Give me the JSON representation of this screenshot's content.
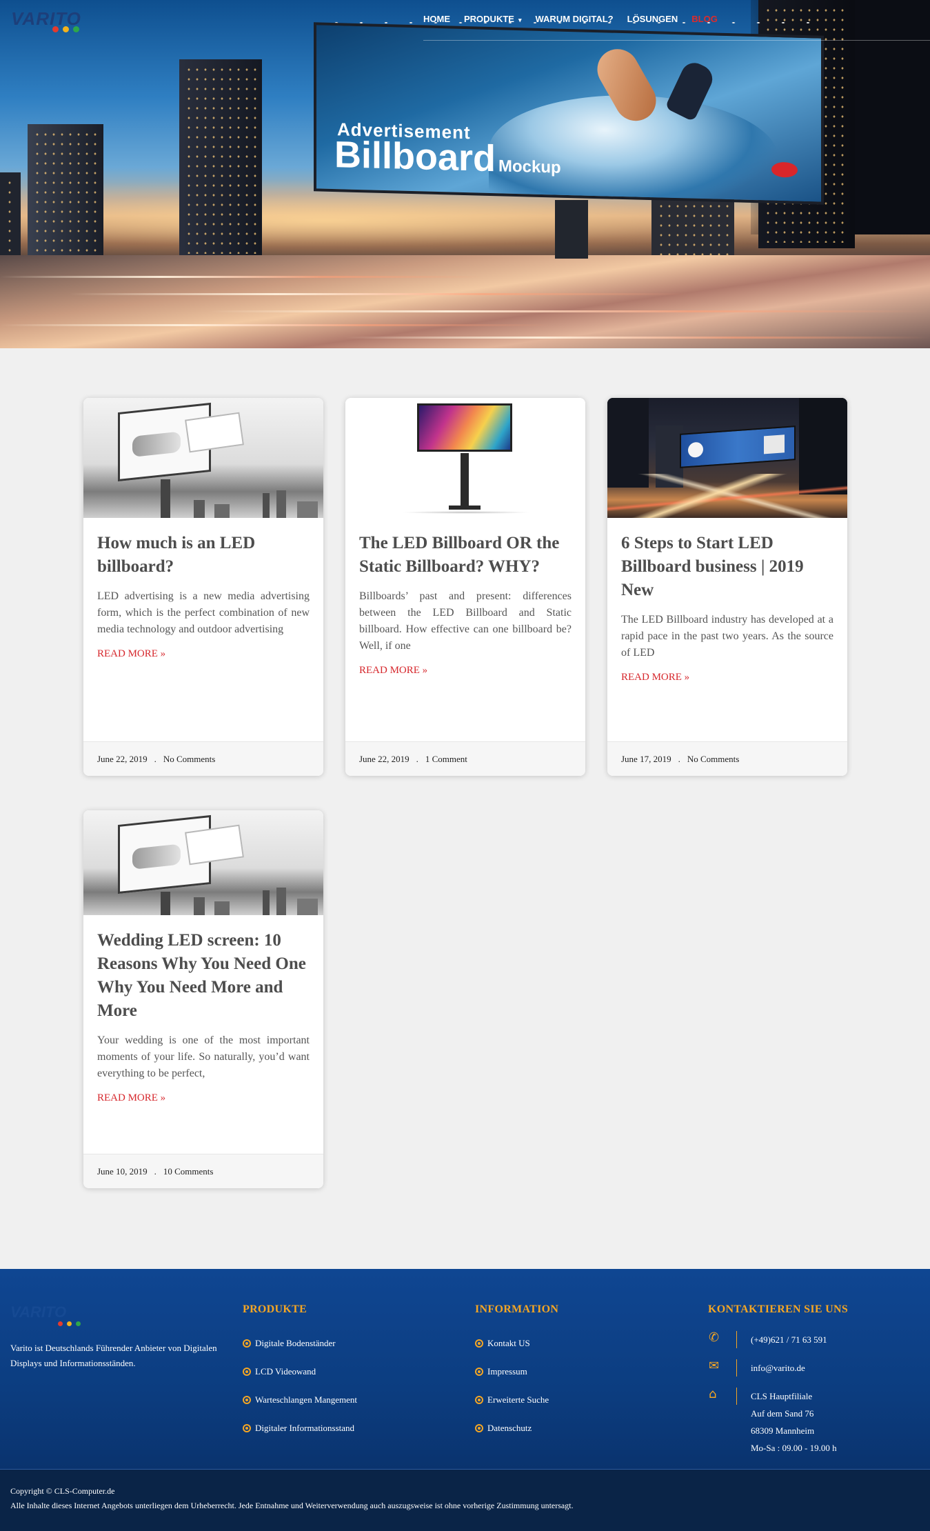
{
  "header": {
    "logo_text": "VARITO",
    "logo_dot_colors": [
      "#e33b2e",
      "#f2b21e",
      "#2fa64a"
    ],
    "nav": [
      {
        "label": "HOME",
        "active": false
      },
      {
        "label": "PRODUKTE",
        "active": false,
        "has_dropdown": true,
        "caret": "▾"
      },
      {
        "label": "WARUM DIGITAL?",
        "active": false
      },
      {
        "label": "LÖSUNGEN",
        "active": false
      },
      {
        "label": "BLOG",
        "active": true
      }
    ]
  },
  "hero": {
    "billboard_line1": "Advertisement",
    "billboard_line2": "Billboard",
    "billboard_line2_small": "Mockup"
  },
  "posts": [
    {
      "title": "How much is an LED billboard?",
      "excerpt": "LED advertising is a new media advertising form, which is the perfect combination of new media technology and outdoor advertising",
      "read_more": "READ MORE »",
      "date": "June 22, 2019",
      "separator": ".",
      "comments": "No Comments",
      "thumb": "bw-billboard-hand"
    },
    {
      "title": "The LED Billboard OR the Static Billboard? WHY?",
      "excerpt": "Billboards’ past and present: differences between the LED Billboard and Static billboard. How effective can one billboard be? Well, if one",
      "read_more": "READ MORE »",
      "date": "June 22, 2019",
      "separator": ".",
      "comments": "1 Comment",
      "thumb": "led-stand-colorful"
    },
    {
      "title": "6 Steps to Start LED Billboard business | 2019 New",
      "excerpt": "The LED Billboard industry has developed at a rapid pace in the past two years. As the source of LED",
      "read_more": "READ MORE »",
      "date": "June 17, 2019",
      "separator": ".",
      "comments": "No Comments",
      "thumb": "night-city-led"
    },
    {
      "title": "Wedding LED screen: 10 Reasons Why You Need One Why You Need More and More",
      "excerpt": "Your wedding is one of the most important moments of your life. So naturally, you’d want everything to be perfect,",
      "read_more": "READ MORE »",
      "date": "June 10, 2019",
      "separator": ".",
      "comments": "10 Comments",
      "thumb": "bw-billboard-hand"
    }
  ],
  "footer": {
    "logo_text": "VARITO",
    "about": "Varito ist Deutschlands Führender Anbieter von Digitalen Displays und Informationsständen.",
    "produkte": {
      "heading": "PRODUKTE",
      "items": [
        "Digitale Bodenständer",
        "LCD Videowand",
        "Warteschlangen Mangement",
        "Digitaler Informationsstand"
      ]
    },
    "information": {
      "heading": "INFORMATION",
      "items": [
        "Kontakt US",
        "Impressum",
        "Erweiterte Suche",
        "Datenschutz"
      ]
    },
    "contact": {
      "heading": "KONTAKTIEREN SIE UNS",
      "phone": "(+49)621 / 71 63 591",
      "email": "info@varito.de",
      "address_lines": [
        "CLS Hauptfiliale",
        "Auf dem Sand 76",
        "68309 Mannheim",
        "Mo-Sa : 09.00 - 19.00 h"
      ]
    },
    "accent_color": "#f5a623",
    "copyright": "Copyright © CLS-Computer.de",
    "legal": "Alle Inhalte dieses Internet Angebots unterliegen dem Urheberrecht. Jede Entnahme und Weiterverwendung auch auszugsweise ist ohne vorherige Zustimmung untersagt."
  }
}
